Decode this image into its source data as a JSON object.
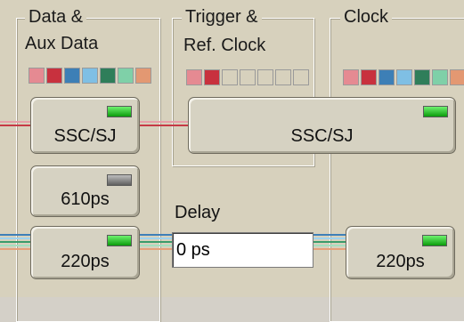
{
  "groups": {
    "data_aux": {
      "title_line1": "Data &",
      "title_line2": "Aux Data"
    },
    "trigger_ref": {
      "title_line1": "Trigger &",
      "title_line2": "Ref. Clock"
    },
    "clock": {
      "title_line1": "Clock"
    }
  },
  "swatch_colors": {
    "data_aux": [
      "#e58a92",
      "#c8313e",
      "#3d7fb6",
      "#7fbfe4",
      "#2f7e5a",
      "#7fd0a8",
      "#e39872"
    ],
    "trigger_ref": [
      "#e58a92",
      "#c8313e",
      "#d7d1bd",
      "#d7d1bd",
      "#d7d1bd",
      "#d7d1bd",
      "#d7d1bd"
    ],
    "clock": [
      "#e58a92",
      "#c8313e",
      "#3d7fb6",
      "#7fbfe4",
      "#2f7e5a",
      "#7fd0a8",
      "#e39872"
    ]
  },
  "buttons": {
    "ssc_left": {
      "label": "SSC/SJ",
      "led": "green"
    },
    "ssc_wide": {
      "label": "SSC/SJ",
      "led": "green"
    },
    "ps610": {
      "label": "610ps",
      "led": "gray"
    },
    "ps220_left": {
      "label": "220ps",
      "led": "green"
    },
    "ps220_right": {
      "label": "220ps",
      "led": "green"
    }
  },
  "delay": {
    "label": "Delay",
    "value": "0 ps"
  },
  "signal_colors": {
    "red_pair": [
      "#e8a0a8",
      "#c63a45"
    ],
    "bus": [
      "#3e7fb8",
      "#9fd3ef",
      "#3a9c6a",
      "#a5dfbf",
      "#e5a07a"
    ]
  }
}
